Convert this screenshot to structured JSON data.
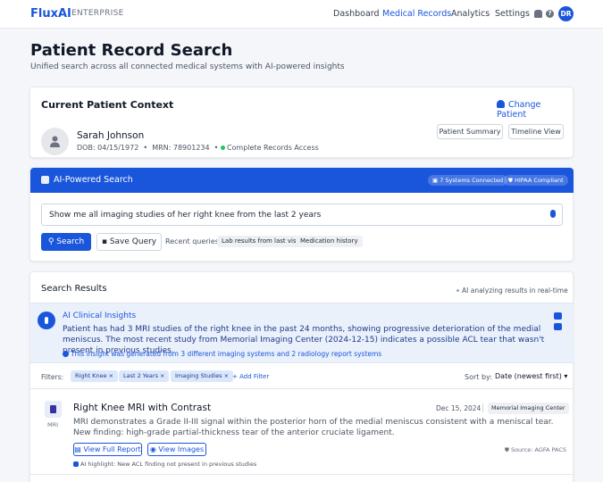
{
  "header": {
    "brand": "FluxAI",
    "brand_sub": "ENTERPRISE",
    "nav": [
      "Dashboard",
      "Medical Records",
      "Analytics",
      "Settings"
    ],
    "active_nav": "Medical Records",
    "icons": [
      "bell-icon",
      "help-icon"
    ],
    "user_initials": "DR"
  },
  "page": {
    "title": "Patient Record Search",
    "subtitle": "Unified search across all connected medical systems with AI-powered insights"
  },
  "context": {
    "title": "Current Patient Context",
    "change_label": "Change Patient",
    "patient_name": "Sarah Johnson",
    "dob": "DOB: 04/15/1972",
    "mrn": "MRN: 78901234",
    "access": "Complete Records Access",
    "summary_btn": "Patient Summary",
    "timeline_btn": "Timeline View"
  },
  "search": {
    "title": "AI-Powered Search",
    "systems": "7 Systems Connected",
    "hipaa": "HIPAA Compliant",
    "query": "Show me all imaging studies of her right knee from the last 2 years",
    "search_btn": "Search",
    "save_btn": "Save Query",
    "recent_label": "Recent queries:",
    "recent": [
      "Lab results from last visit",
      "Medication history"
    ]
  },
  "results": {
    "title": "Search Results",
    "status": "AI analyzing results in real-time",
    "insight_title": "AI Clinical Insights",
    "insight_text": "Patient has had 3 MRI studies of the right knee in the past 24 months, showing progressive deterioration of the medial meniscus. The most recent study from Memorial Imaging Center (2024-12-15) indicates a possible ACL tear that wasn't present in previous studies.",
    "insight_note": "This insight was generated from 3 different imaging systems and 2 radiology report systems",
    "filters_label": "Filters:",
    "filters": [
      "Right Knee ×",
      "Last 2 Years ×",
      "Imaging Studies ×"
    ],
    "add_filter": "+ Add Filter",
    "sort_label": "Sort by:",
    "sort_value": "Date (newest first) ▾",
    "items": [
      {
        "type": "MRI",
        "title": "Right Knee MRI with Contrast",
        "date": "Dec 15, 2024",
        "facility": "Memorial Imaging Center",
        "description": "MRI demonstrates a Grade II-III signal within the posterior horn of the medial meniscus consistent with a meniscal tear. New finding: high-grade partial-thickness tear of the anterior cruciate ligament.",
        "view_report": "View Full Report",
        "view_images": "View Images",
        "source": "Source: AGFA PACS",
        "ai_highlight": "AI highlight: New ACL finding not present in previous studies"
      }
    ]
  }
}
